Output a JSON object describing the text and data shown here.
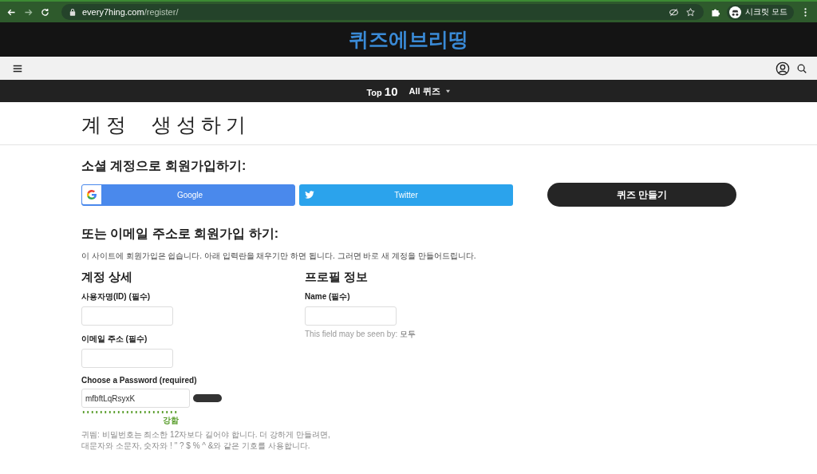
{
  "browser": {
    "url_host": "every7hing.com",
    "url_path": "/register/",
    "profile": "시크릿 모드"
  },
  "site": {
    "logo": "퀴즈에브리띵"
  },
  "nav": {
    "top_label": "Top",
    "top_number": "10",
    "menu": "All 퀴즈"
  },
  "page": {
    "title": "계정  생성하기"
  },
  "social": {
    "heading": "소셜 계정으로 회원가입하기:",
    "buttons": [
      {
        "kind": "google",
        "label": "Google"
      },
      {
        "kind": "twitter",
        "label": "Twitter"
      }
    ],
    "make_quiz": "퀴즈 만들기"
  },
  "email": {
    "heading": "또는 이메일 주소로 회원가입 하기:",
    "intro": "이 사이트에 회원가입은 쉽습니다. 아래 입력란을 채우기만 하면 됩니다. 그러면 바로 새 계정을 만들어드립니다."
  },
  "account": {
    "heading": "계정 상세",
    "username_label": "사용자명(ID) (필수)",
    "email_label": "이메일 주소 (필수)",
    "password_label": "Choose a Password (required)",
    "password_value": "mfbftLqRsyxK",
    "strength": "강함",
    "hint_lines": [
      "귀띔: 비밀번호는 최소한 12자보다 길어야 합니다. 더 강하게 만들려면,",
      "대문자와 소문자, 숫자와 ! \" ? $ % ^ &와 같은 기호를 사용합니다."
    ]
  },
  "profile": {
    "heading": "프로필 정보",
    "name_label": "Name (필수)",
    "visibility_label": "This field may be seen by:",
    "visibility_value": "모두"
  }
}
